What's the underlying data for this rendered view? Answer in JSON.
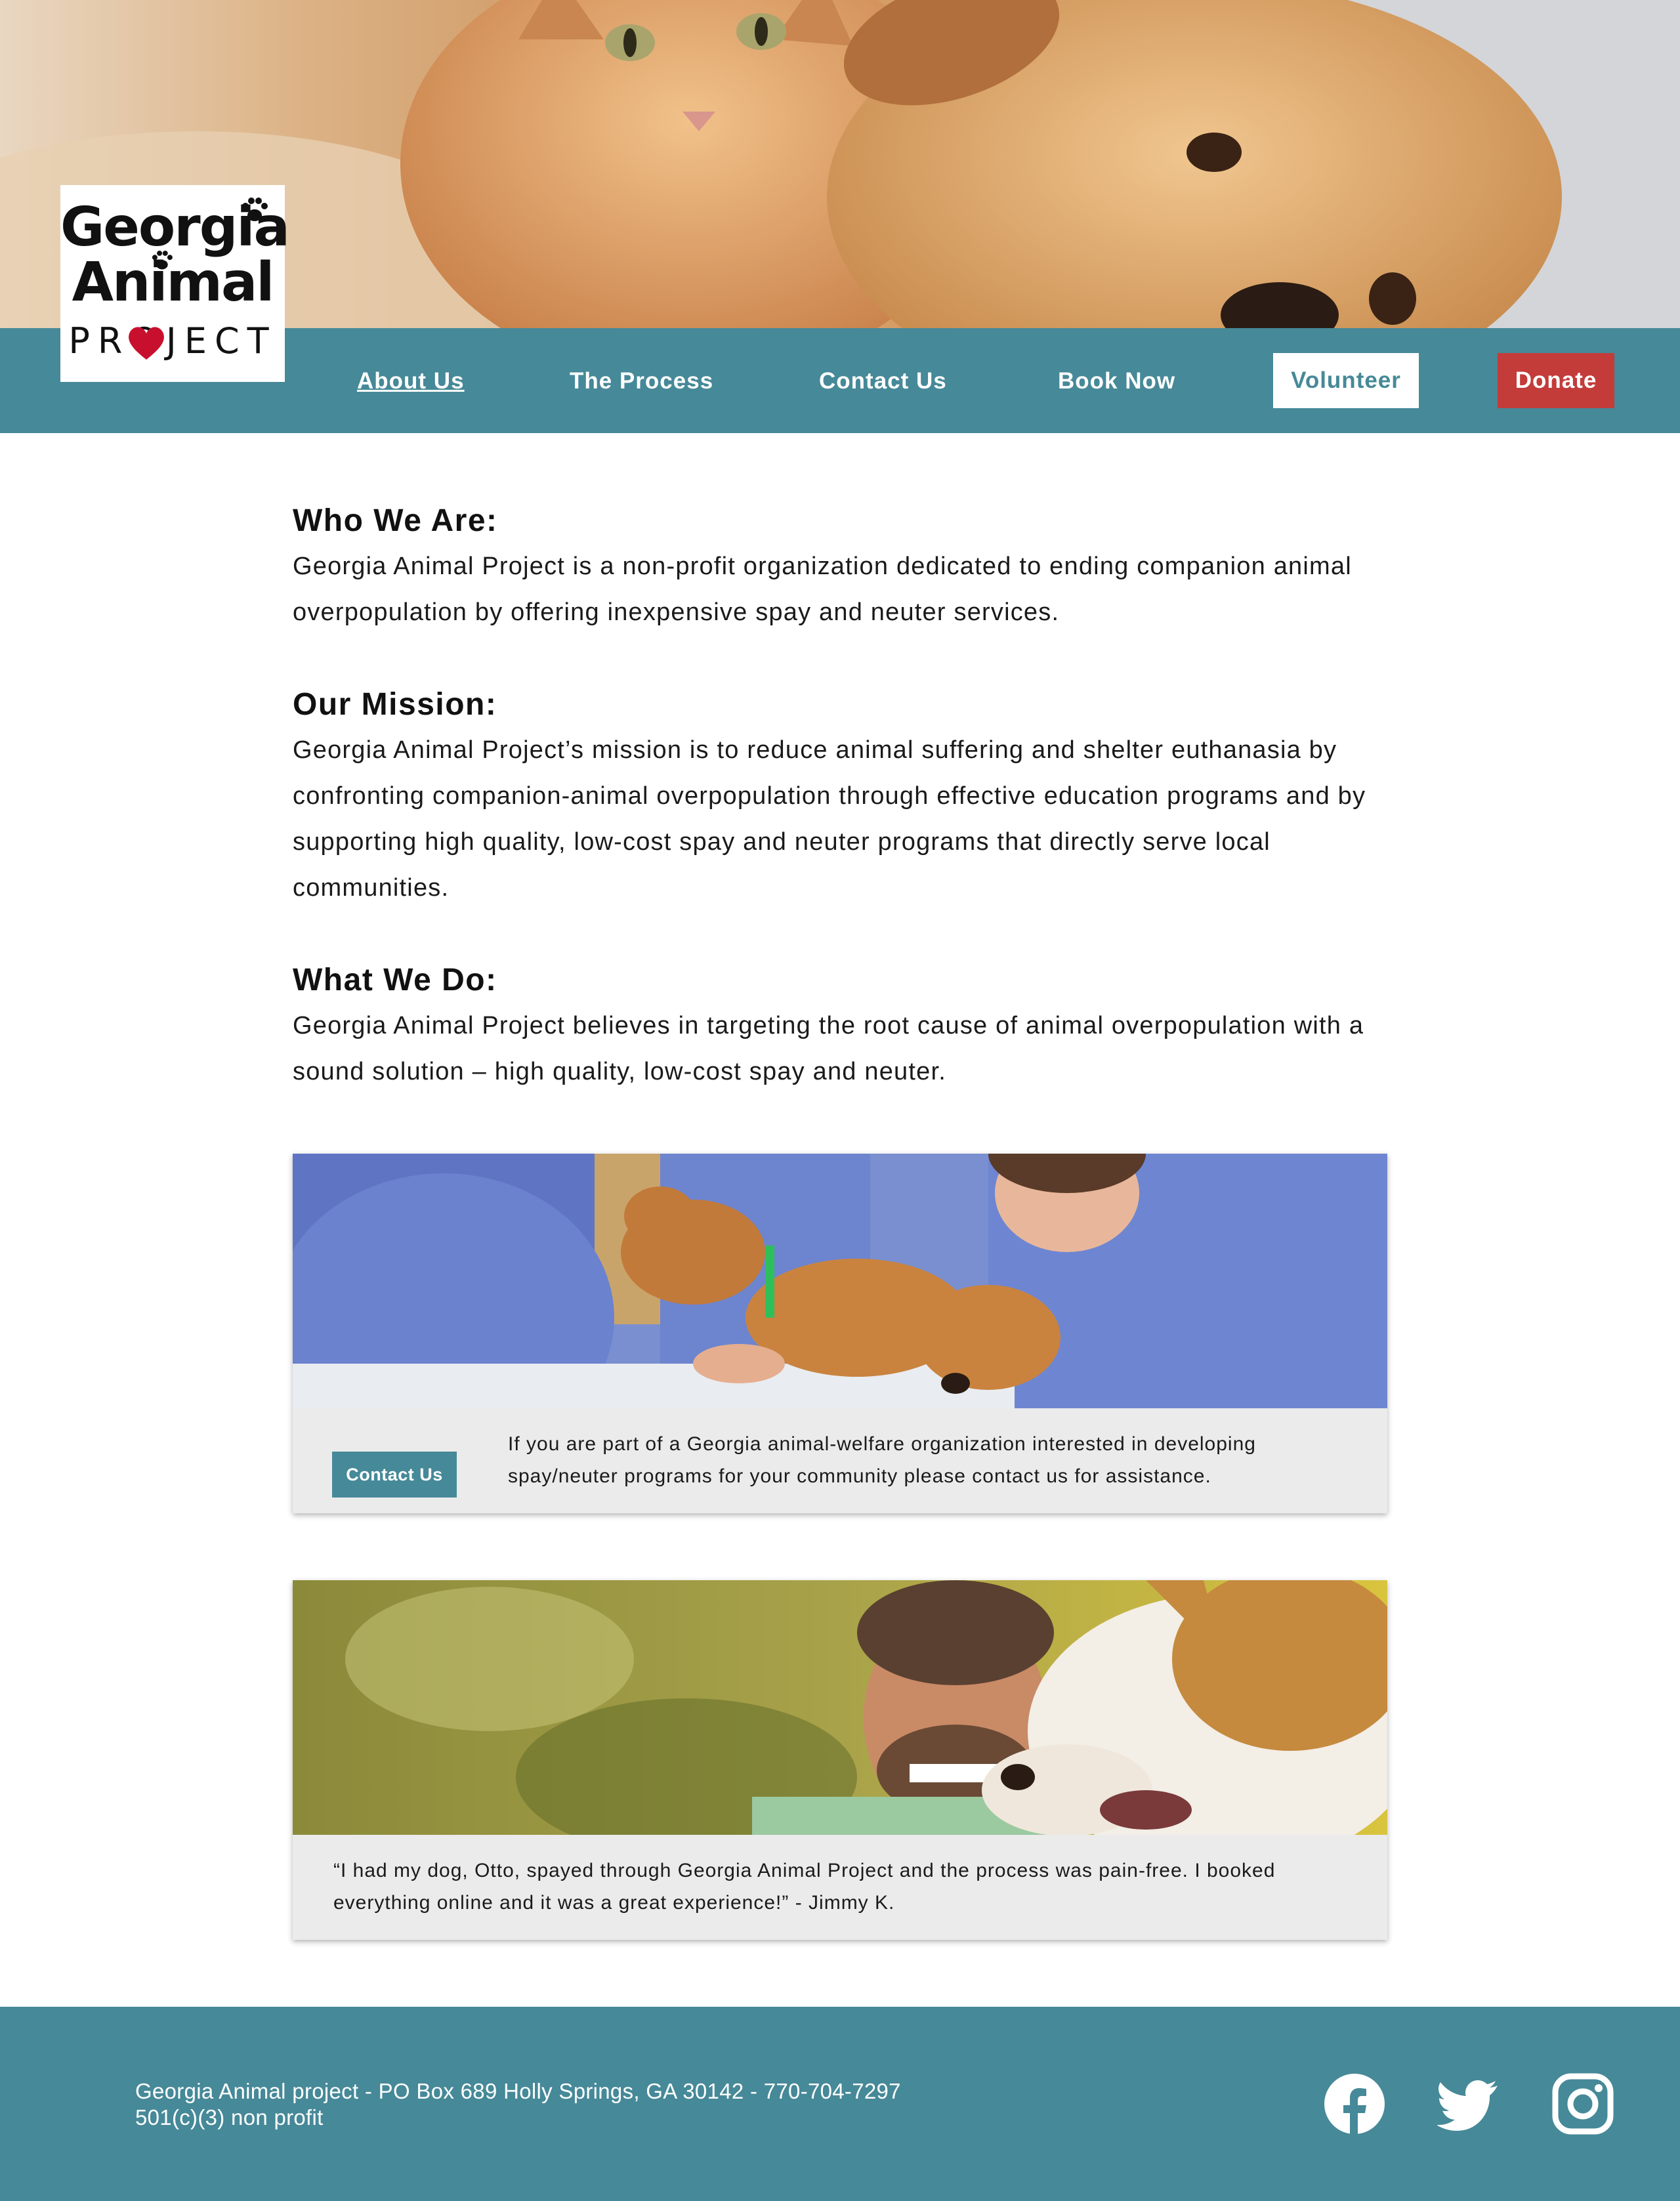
{
  "logo": {
    "line1": "Georgia",
    "line2": "Animal",
    "line3": "PROJECT"
  },
  "nav": {
    "items": [
      {
        "label": "About Us",
        "active": true
      },
      {
        "label": "The Process"
      },
      {
        "label": "Contact Us"
      },
      {
        "label": "Book Now"
      }
    ],
    "volunteer_label": "Volunteer",
    "donate_label": "Donate"
  },
  "sections": [
    {
      "title": "Who We Are:",
      "body": "Georgia Animal Project is a non-profit organization dedicated to ending companion animal overpopulation by offering inexpensive spay and neuter services."
    },
    {
      "title": "Our Mission:",
      "body": "Georgia Animal Project’s mission is to reduce animal suffering and shelter euthanasia by confronting companion-animal overpopulation through effective education programs and by supporting high quality, low-cost spay and neuter programs that directly serve local communities."
    },
    {
      "title": "What We Do:",
      "body": "Georgia Animal Project believes in targeting the root cause of animal overpopulation with a sound solution – high quality, low-cost spay and neuter."
    }
  ],
  "cards": {
    "contact": {
      "button_label": "Contact Us",
      "text": "If you are part of a Georgia animal-welfare organization interested in developing spay/neuter programs for your community please contact us for assistance."
    },
    "testimonial": {
      "text": "“I had my dog, Otto, spayed through Georgia Animal Project and the process was pain-free. I booked everything online and it was a great experience!” - Jimmy K."
    }
  },
  "footer": {
    "address": "Georgia Animal project - PO Box 689 Holly Springs, GA 30142 - 770-704-7297",
    "nonprofit": "501(c)(3) non profit",
    "social": [
      "facebook-icon",
      "twitter-icon",
      "instagram-icon"
    ]
  },
  "colors": {
    "teal": "#468998",
    "donate_red": "#c33c3a",
    "card_bg": "#ebebeb"
  }
}
